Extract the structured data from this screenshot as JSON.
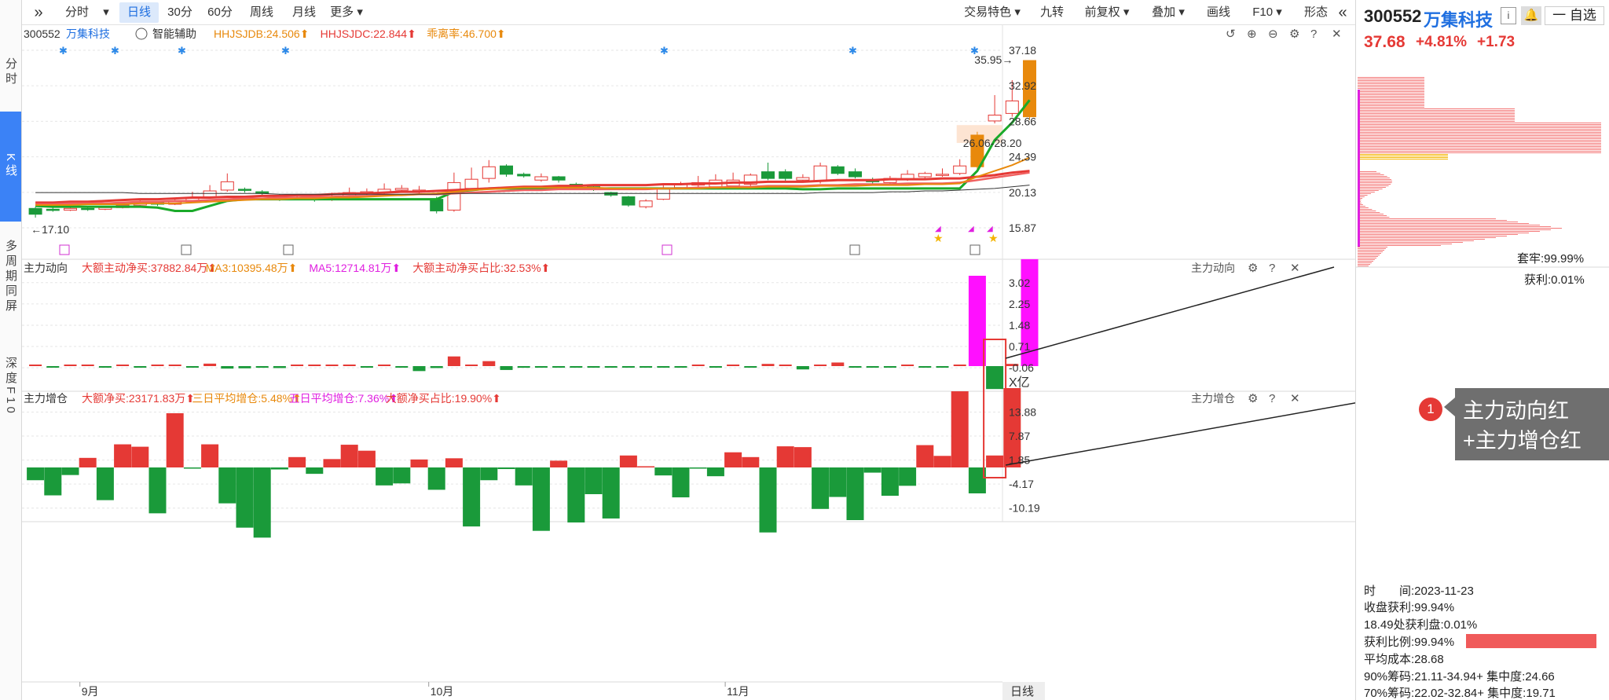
{
  "nav": {
    "items": [
      "分时",
      "K线",
      "多周期同屏",
      "深度F10"
    ],
    "active": 1
  },
  "toolbar": {
    "expand_icon": "»",
    "collapse_icon": "«",
    "left_buttons": [
      "分时",
      "日线",
      "30分",
      "60分",
      "周线",
      "月线",
      "更多"
    ],
    "active_left": 1,
    "right_buttons": [
      "交易特色",
      "九转",
      "前复权",
      "叠加",
      "画线",
      "F10",
      "形态"
    ]
  },
  "header": {
    "code": "300552",
    "name": "万集科技",
    "assist_label": "智能辅助",
    "indicators": [
      {
        "text": "HHJSJDB:24.506",
        "color": "#e8890c"
      },
      {
        "text": "HHJSJDC:22.844",
        "color": "#e53935"
      },
      {
        "text": "乖离率:46.700",
        "color": "#e8890c"
      }
    ]
  },
  "panel2": {
    "title": "主力动向",
    "right_title": "主力动向",
    "indicators": [
      {
        "text": "大额主动净买:37882.84万",
        "color": "#e53935"
      },
      {
        "text": "MA3:10395.48万",
        "color": "#e8890c"
      },
      {
        "text": "MA5:12714.81万",
        "color": "#e020e0"
      },
      {
        "text": "大额主动净买占比:32.53%",
        "color": "#e53935"
      }
    ],
    "unit": "X亿"
  },
  "panel3": {
    "title": "主力增仓",
    "right_title": "主力增仓",
    "indicators": [
      {
        "text": "大额净买:23171.83万",
        "color": "#e53935"
      },
      {
        "text": "三日平均增仓:5.48%",
        "color": "#e8890c"
      },
      {
        "text": "五日平均增仓:7.36%",
        "color": "#e020e0"
      },
      {
        "text": "大额净买占比:19.90%",
        "color": "#e53935"
      }
    ]
  },
  "bottom_axis": {
    "months": [
      {
        "label": "9月",
        "index": 3
      },
      {
        "label": "10月",
        "index": 23
      },
      {
        "label": "11月",
        "index": 40
      }
    ],
    "period_label": "日线"
  },
  "right_panel": {
    "code": "300552",
    "name": "万集科技",
    "info_icon": "i",
    "bell_icon": "bell-icon",
    "watch_label": "一 自选",
    "price": "37.68",
    "change_pct": "+4.81%",
    "change": "+1.73",
    "trapped_label": "套牢:99.99%",
    "profit_label": "获利:0.01%",
    "stats": [
      "时　　间:2023-11-23",
      "收盘获利:99.94%",
      "18.49处获利盘:0.01%",
      "获利比例:99.94%",
      "平均成本:28.68",
      "90%筹码:21.11-34.94+ 集中度:24.66",
      "70%筹码:22.02-32.84+ 集中度:19.71"
    ]
  },
  "callout": {
    "badge": "1",
    "line1": "主力动向红",
    "line2": "+主力增仓红"
  },
  "colors": {
    "up": "#e53935",
    "down": "#1a9a3a",
    "orange": "#e8890c",
    "magenta": "#ff10ff",
    "green_line": "#1aaa2a",
    "blue": "#1f6fe0"
  },
  "chart_data": [
    {
      "type": "candlestick",
      "title": "万集科技 日K",
      "yticks": [
        15.87,
        20.13,
        24.39,
        28.66,
        32.92,
        37.18
      ],
      "ylim": [
        14.9,
        38.1
      ],
      "annotations": [
        {
          "text": "35.95",
          "index": 56
        },
        {
          "text": "17.10",
          "index": 0
        },
        {
          "text": "26.06-28.20"
        }
      ],
      "candles": [
        [
          18.2,
          17.5,
          18.4,
          17.1
        ],
        [
          18.1,
          18.0,
          18.3,
          17.8
        ],
        [
          18.0,
          18.2,
          18.4,
          17.9
        ],
        [
          18.2,
          18.1,
          18.4,
          17.9
        ],
        [
          18.1,
          18.3,
          18.5,
          18.0
        ],
        [
          18.3,
          18.6,
          18.8,
          18.2
        ],
        [
          18.6,
          18.9,
          19.2,
          18.5
        ],
        [
          18.9,
          18.7,
          19.1,
          18.5
        ],
        [
          18.7,
          19.0,
          19.4,
          18.6
        ],
        [
          19.0,
          19.4,
          20.2,
          18.9
        ],
        [
          19.6,
          20.3,
          21.0,
          19.4
        ],
        [
          20.4,
          21.4,
          22.4,
          20.2
        ],
        [
          20.5,
          20.4,
          20.7,
          20.1
        ],
        [
          20.2,
          20.0,
          20.4,
          19.7
        ],
        [
          19.6,
          19.5,
          19.9,
          19.1
        ],
        [
          19.4,
          19.5,
          19.8,
          19.2
        ],
        [
          19.5,
          19.3,
          19.8,
          19.0
        ],
        [
          19.3,
          19.6,
          20.1,
          19.1
        ],
        [
          19.6,
          20.1,
          20.7,
          19.4
        ],
        [
          20.0,
          20.2,
          20.6,
          19.8
        ],
        [
          20.1,
          20.5,
          21.2,
          19.9
        ],
        [
          20.4,
          20.6,
          21.0,
          20.2
        ],
        [
          20.2,
          20.4,
          20.9,
          20.0
        ],
        [
          19.3,
          17.9,
          19.6,
          17.6
        ],
        [
          18.0,
          21.3,
          22.5,
          17.8
        ],
        [
          20.6,
          21.7,
          23.1,
          20.4
        ],
        [
          21.8,
          23.2,
          24.0,
          21.3
        ],
        [
          23.3,
          22.3,
          23.5,
          22.0
        ],
        [
          22.3,
          22.1,
          22.5,
          21.9
        ],
        [
          21.6,
          22.0,
          22.4,
          21.4
        ],
        [
          22.0,
          21.6,
          22.1,
          21.3
        ],
        [
          21.1,
          20.7,
          21.3,
          20.5
        ],
        [
          20.8,
          20.6,
          20.9,
          20.3
        ],
        [
          20.1,
          19.8,
          20.2,
          19.6
        ],
        [
          19.6,
          18.6,
          19.7,
          18.4
        ],
        [
          18.4,
          19.1,
          19.3,
          18.2
        ],
        [
          19.3,
          20.6,
          21.1,
          19.2
        ],
        [
          20.7,
          21.1,
          21.4,
          20.5
        ],
        [
          21.0,
          21.3,
          22.1,
          20.8
        ],
        [
          20.8,
          21.6,
          22.3,
          20.6
        ],
        [
          20.9,
          21.6,
          22.5,
          20.7
        ],
        [
          21.1,
          22.2,
          22.4,
          20.9
        ],
        [
          22.6,
          21.8,
          23.7,
          21.6
        ],
        [
          22.6,
          21.8,
          22.9,
          21.4
        ],
        [
          21.6,
          21.9,
          22.3,
          21.4
        ],
        [
          21.5,
          23.3,
          23.7,
          21.2
        ],
        [
          23.2,
          22.4,
          23.4,
          22.2
        ],
        [
          22.6,
          22.0,
          23.0,
          21.8
        ],
        [
          21.6,
          21.4,
          21.9,
          21.1
        ],
        [
          21.3,
          21.8,
          22.1,
          21.0
        ],
        [
          21.7,
          22.3,
          22.8,
          21.5
        ],
        [
          22.0,
          22.4,
          22.6,
          21.7
        ],
        [
          22.2,
          22.3,
          23.0,
          22.0
        ],
        [
          22.4,
          23.3,
          24.1,
          22.2
        ],
        [
          27.0,
          23.2,
          27.4,
          22.9
        ],
        [
          28.7,
          29.4,
          31.8,
          28.4
        ],
        [
          29.6,
          31.1,
          33.6,
          29.2
        ],
        [
          35.95,
          29.2,
          35.95,
          28.8
        ]
      ],
      "series": [
        {
          "name": "green",
          "values": [
            18.5,
            18.4,
            18.4,
            18.4,
            18.4,
            18.4,
            18.4,
            18.3,
            17.9,
            17.9,
            18.5,
            19.1,
            19.3,
            19.3,
            19.3,
            19.3,
            19.3,
            19.3,
            19.3,
            19.3,
            19.3,
            19.3,
            19.3,
            19.3,
            20.2,
            20.4,
            20.6,
            20.6,
            20.6,
            20.6,
            20.6,
            20.6,
            20.6,
            20.6,
            20.6,
            20.6,
            20.6,
            20.6,
            20.6,
            20.6,
            20.6,
            20.6,
            20.6,
            20.6,
            20.5,
            20.5,
            20.6,
            20.6,
            20.6,
            20.6,
            20.6,
            20.6,
            20.6,
            20.6,
            22.7,
            26.4,
            28.5,
            31.2
          ]
        },
        {
          "name": "red1",
          "values": [
            18.9,
            18.9,
            19.0,
            19.0,
            19.1,
            19.2,
            19.3,
            19.3,
            19.4,
            19.5,
            19.5,
            19.6,
            19.6,
            19.7,
            19.7,
            19.8,
            19.8,
            19.9,
            20.0,
            20.0,
            20.1,
            20.2,
            20.2,
            20.3,
            20.4,
            20.5,
            20.6,
            20.7,
            20.8,
            20.8,
            20.9,
            20.9,
            21.0,
            21.0,
            21.0,
            21.0,
            21.1,
            21.1,
            21.2,
            21.2,
            21.3,
            21.3,
            21.4,
            21.4,
            21.4,
            21.5,
            21.6,
            21.6,
            21.6,
            21.7,
            21.7,
            21.7,
            21.8,
            21.8,
            22.0,
            22.2,
            22.5,
            22.7
          ]
        },
        {
          "name": "red2",
          "values": [
            18.7,
            18.7,
            18.8,
            18.8,
            18.8,
            18.9,
            19.0,
            19.0,
            19.1,
            19.1,
            19.2,
            19.3,
            19.4,
            19.4,
            19.5,
            19.5,
            19.6,
            19.6,
            19.7,
            19.7,
            19.8,
            19.8,
            19.9,
            19.9,
            20.0,
            20.1,
            20.2,
            20.3,
            20.4,
            20.4,
            20.5,
            20.5,
            20.5,
            20.5,
            20.5,
            20.5,
            20.6,
            20.6,
            20.7,
            20.7,
            20.8,
            20.8,
            20.9,
            20.9,
            20.9,
            21.0,
            21.0,
            21.1,
            21.1,
            21.1,
            21.2,
            21.2,
            21.2,
            21.3,
            21.6,
            21.9,
            22.2,
            22.5
          ]
        },
        {
          "name": "orange",
          "values": [
            18.6,
            18.6,
            18.6,
            18.7,
            18.7,
            18.7,
            18.8,
            18.8,
            18.8,
            18.9,
            19.0,
            19.1,
            19.2,
            19.3,
            19.3,
            19.4,
            19.4,
            19.5,
            19.5,
            19.6,
            19.7,
            19.8,
            19.9,
            20.0,
            20.2,
            20.4,
            20.5,
            20.6,
            20.7,
            20.7,
            20.7,
            20.7,
            20.7,
            20.6,
            20.6,
            20.6,
            20.6,
            20.6,
            20.6,
            20.7,
            20.7,
            20.7,
            20.8,
            20.8,
            20.8,
            20.9,
            20.9,
            20.9,
            21.0,
            21.0,
            21.0,
            21.1,
            21.1,
            21.2,
            22.0,
            22.7,
            23.4,
            24.3
          ]
        },
        {
          "name": "dark",
          "values": [
            20.1,
            20.1,
            20.1,
            20.1,
            20.1,
            20.1,
            20.0,
            20.0,
            20.0,
            20.0,
            20.0,
            20.0,
            20.0,
            20.0,
            19.9,
            19.9,
            19.9,
            19.9,
            19.9,
            19.9,
            19.9,
            19.9,
            19.9,
            19.9,
            20.0,
            20.0,
            20.0,
            20.0,
            20.0,
            20.0,
            20.0,
            20.0,
            20.0,
            20.0,
            20.0,
            20.0,
            20.0,
            20.0,
            20.0,
            20.0,
            20.0,
            20.0,
            20.0,
            20.0,
            20.0,
            20.1,
            20.1,
            20.1,
            20.1,
            20.2,
            20.2,
            20.3,
            20.3,
            20.4,
            20.5,
            20.6,
            20.8,
            21.0
          ]
        }
      ]
    },
    {
      "type": "bar",
      "title": "主力动向",
      "ylabel": "X亿",
      "yticks": [
        3.02,
        2.25,
        1.48,
        0.71,
        -0.06
      ],
      "ylim": [
        -0.98,
        3.9
      ],
      "values": [
        0.02,
        -0.01,
        0.02,
        0.02,
        -0.01,
        0.02,
        -0.02,
        0.02,
        0.05,
        -0.02,
        0.09,
        -0.09,
        -0.08,
        -0.06,
        -0.07,
        0.02,
        0.01,
        0.02,
        0.03,
        -0.03,
        0.04,
        -0.02,
        -0.18,
        -0.07,
        0.35,
        0.02,
        0.18,
        -0.14,
        -0.06,
        -0.04,
        -0.05,
        -0.02,
        -0.03,
        -0.03,
        -0.02,
        -0.04,
        -0.05,
        -0.05,
        0.02,
        -0.03,
        0.05,
        -0.03,
        0.08,
        0.05,
        -0.12,
        0.03,
        0.13,
        -0.03,
        -0.02,
        -0.03,
        0.05,
        -0.02,
        -0.04,
        0.02,
        3.27,
        -0.83,
        0.08,
        3.87
      ]
    },
    {
      "type": "bar",
      "title": "主力增仓",
      "yticks": [
        13.88,
        7.87,
        1.85,
        -4.17,
        -10.19
      ],
      "ylim": [
        -17.5,
        21.5
      ],
      "values": [
        -3.2,
        -7.0,
        -1.9,
        2.4,
        -8.2,
        5.8,
        5.2,
        -11.5,
        13.6,
        -0.2,
        5.8,
        -9.0,
        -15.1,
        -17.6,
        -0.5,
        2.6,
        -1.6,
        2.1,
        5.7,
        4.2,
        -4.5,
        -4.0,
        2.0,
        -5.6,
        2.3,
        -14.8,
        -3.2,
        -0.4,
        -4.5,
        -15.9,
        1.7,
        -13.8,
        -6.7,
        -12.8,
        3.0,
        0.3,
        -2.0,
        -7.5,
        -0.2,
        -2.2,
        3.8,
        2.6,
        -16.3,
        5.3,
        5.1,
        -10.4,
        -7.4,
        -13.2,
        -1.3,
        -7.1,
        -4.6,
        5.6,
        2.9,
        19.1,
        -6.5,
        3.0,
        19.9
      ]
    }
  ]
}
